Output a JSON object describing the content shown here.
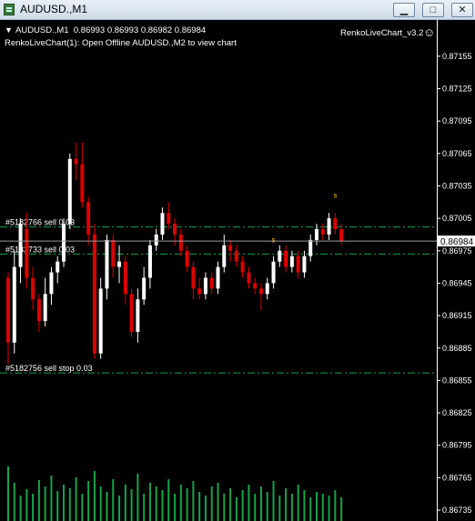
{
  "window": {
    "title": "AUDUSD.,M1",
    "minimize_glyph": "▁",
    "restore_glyph": "□",
    "close_glyph": "✕"
  },
  "chart_header": {
    "symbol_line": "AUDUSD.,M1  0.86993 0.86993 0.86982 0.86984",
    "status_line": "RenkoLiveChart(1): Open Offline AUDUSD.,M2 to view chart",
    "indicator": "RenkoLiveChart_v3.2",
    "dropdown_glyph": "▼",
    "smiley_glyph": "☺"
  },
  "colors": {
    "background": "#000000",
    "bull": "#ffffff",
    "bear": "#e00000",
    "grid_line": "#17a34a",
    "axis_text": "#ffffff",
    "marker": "#f2c200",
    "price_tag_bg": "#ffffff"
  },
  "price_axis": {
    "ticks": [
      "0.87155",
      "0.87125",
      "0.87095",
      "0.87065",
      "0.87035",
      "0.87005",
      "0.86975",
      "0.86945",
      "0.86915",
      "0.86885",
      "0.86855",
      "0.86825",
      "0.86795",
      "0.86765",
      "0.86735"
    ],
    "current_price_label": "0.86984",
    "current_price": 0.86984
  },
  "order_lines": [
    {
      "label": "#5182766 sell 0.03",
      "price": 0.86997
    },
    {
      "label": "#5182733 sell 0.03",
      "price": 0.86972
    },
    {
      "label": "#5182756 sell stop 0.03",
      "price": 0.86862
    }
  ],
  "signal_markers": [
    {
      "label": "s",
      "bar": 43,
      "price": 0.86983
    },
    {
      "label": "s",
      "bar": 53,
      "price": 0.87024
    }
  ],
  "chart_data": {
    "type": "candlestick",
    "y_range": [
      0.8673,
      0.8717
    ],
    "candles": [
      {
        "o": 0.8695,
        "c": 0.8689,
        "h": 0.86955,
        "l": 0.8687
      },
      {
        "o": 0.8689,
        "c": 0.8696,
        "h": 0.86975,
        "l": 0.8688
      },
      {
        "o": 0.8696,
        "c": 0.87,
        "h": 0.87005,
        "l": 0.86945
      },
      {
        "o": 0.86995,
        "c": 0.8695,
        "h": 0.8701,
        "l": 0.8694
      },
      {
        "o": 0.8695,
        "c": 0.8693,
        "h": 0.8696,
        "l": 0.8692
      },
      {
        "o": 0.8693,
        "c": 0.8691,
        "h": 0.86935,
        "l": 0.869
      },
      {
        "o": 0.8691,
        "c": 0.86935,
        "h": 0.8695,
        "l": 0.86905
      },
      {
        "o": 0.86935,
        "c": 0.86955,
        "h": 0.8696,
        "l": 0.86925
      },
      {
        "o": 0.86955,
        "c": 0.86965,
        "h": 0.8697,
        "l": 0.86945
      },
      {
        "o": 0.86965,
        "c": 0.87,
        "h": 0.87005,
        "l": 0.8696
      },
      {
        "o": 0.87,
        "c": 0.8706,
        "h": 0.87065,
        "l": 0.86995
      },
      {
        "o": 0.8706,
        "c": 0.87055,
        "h": 0.87075,
        "l": 0.8704
      },
      {
        "o": 0.87055,
        "c": 0.8702,
        "h": 0.87075,
        "l": 0.87015
      },
      {
        "o": 0.8702,
        "c": 0.8699,
        "h": 0.87025,
        "l": 0.8698
      },
      {
        "o": 0.8699,
        "c": 0.8688,
        "h": 0.87,
        "l": 0.86875
      },
      {
        "o": 0.8688,
        "c": 0.8694,
        "h": 0.8695,
        "l": 0.86875
      },
      {
        "o": 0.8694,
        "c": 0.86985,
        "h": 0.8699,
        "l": 0.8693
      },
      {
        "o": 0.86985,
        "c": 0.8696,
        "h": 0.8699,
        "l": 0.8695
      },
      {
        "o": 0.8696,
        "c": 0.86965,
        "h": 0.8698,
        "l": 0.86945
      },
      {
        "o": 0.86965,
        "c": 0.86935,
        "h": 0.8697,
        "l": 0.86925
      },
      {
        "o": 0.86935,
        "c": 0.869,
        "h": 0.8694,
        "l": 0.86895
      },
      {
        "o": 0.869,
        "c": 0.8693,
        "h": 0.8694,
        "l": 0.8689
      },
      {
        "o": 0.8693,
        "c": 0.8695,
        "h": 0.8696,
        "l": 0.86925
      },
      {
        "o": 0.8695,
        "c": 0.8698,
        "h": 0.86985,
        "l": 0.8694
      },
      {
        "o": 0.8698,
        "c": 0.8699,
        "h": 0.86995,
        "l": 0.86975
      },
      {
        "o": 0.8699,
        "c": 0.8701,
        "h": 0.87015,
        "l": 0.86985
      },
      {
        "o": 0.8701,
        "c": 0.87,
        "h": 0.8702,
        "l": 0.86995
      },
      {
        "o": 0.87,
        "c": 0.8699,
        "h": 0.87005,
        "l": 0.8698
      },
      {
        "o": 0.8699,
        "c": 0.86975,
        "h": 0.86995,
        "l": 0.8697
      },
      {
        "o": 0.86975,
        "c": 0.8696,
        "h": 0.8698,
        "l": 0.86955
      },
      {
        "o": 0.8696,
        "c": 0.8694,
        "h": 0.86965,
        "l": 0.8693
      },
      {
        "o": 0.8694,
        "c": 0.86935,
        "h": 0.8695,
        "l": 0.8693
      },
      {
        "o": 0.86935,
        "c": 0.8695,
        "h": 0.86955,
        "l": 0.8693
      },
      {
        "o": 0.8695,
        "c": 0.8694,
        "h": 0.86955,
        "l": 0.86935
      },
      {
        "o": 0.8694,
        "c": 0.8696,
        "h": 0.86965,
        "l": 0.86935
      },
      {
        "o": 0.8696,
        "c": 0.8698,
        "h": 0.8699,
        "l": 0.86955
      },
      {
        "o": 0.8698,
        "c": 0.86975,
        "h": 0.86985,
        "l": 0.86965
      },
      {
        "o": 0.86975,
        "c": 0.86965,
        "h": 0.8698,
        "l": 0.8696
      },
      {
        "o": 0.86965,
        "c": 0.86955,
        "h": 0.8697,
        "l": 0.8695
      },
      {
        "o": 0.86955,
        "c": 0.86945,
        "h": 0.8696,
        "l": 0.8694
      },
      {
        "o": 0.86945,
        "c": 0.8694,
        "h": 0.8695,
        "l": 0.86935
      },
      {
        "o": 0.8694,
        "c": 0.86935,
        "h": 0.86945,
        "l": 0.8692
      },
      {
        "o": 0.86935,
        "c": 0.86945,
        "h": 0.8695,
        "l": 0.8693
      },
      {
        "o": 0.86945,
        "c": 0.86965,
        "h": 0.8697,
        "l": 0.8694
      },
      {
        "o": 0.86965,
        "c": 0.86975,
        "h": 0.8698,
        "l": 0.8696
      },
      {
        "o": 0.86975,
        "c": 0.8696,
        "h": 0.8698,
        "l": 0.86955
      },
      {
        "o": 0.8696,
        "c": 0.8697,
        "h": 0.86975,
        "l": 0.86955
      },
      {
        "o": 0.8697,
        "c": 0.86955,
        "h": 0.86975,
        "l": 0.8695
      },
      {
        "o": 0.86955,
        "c": 0.8697,
        "h": 0.86975,
        "l": 0.8695
      },
      {
        "o": 0.8697,
        "c": 0.86985,
        "h": 0.8699,
        "l": 0.86965
      },
      {
        "o": 0.86985,
        "c": 0.86995,
        "h": 0.87,
        "l": 0.8698
      },
      {
        "o": 0.86995,
        "c": 0.8699,
        "h": 0.87,
        "l": 0.86985
      },
      {
        "o": 0.8699,
        "c": 0.87005,
        "h": 0.8701,
        "l": 0.86985
      },
      {
        "o": 0.87005,
        "c": 0.86995,
        "h": 0.8701,
        "l": 0.8699
      },
      {
        "o": 0.86995,
        "c": 0.86984,
        "h": 0.87,
        "l": 0.8698
      }
    ],
    "volume": [
      60,
      42,
      28,
      35,
      30,
      45,
      38,
      50,
      33,
      40,
      36,
      48,
      30,
      44,
      55,
      38,
      32,
      46,
      28,
      40,
      35,
      52,
      30,
      42,
      38,
      34,
      46,
      30,
      40,
      36,
      44,
      32,
      28,
      38,
      42,
      30,
      36,
      26,
      34,
      40,
      30,
      38,
      32,
      44,
      28,
      36,
      30,
      40,
      34,
      26,
      32,
      30,
      28,
      34,
      26
    ]
  }
}
